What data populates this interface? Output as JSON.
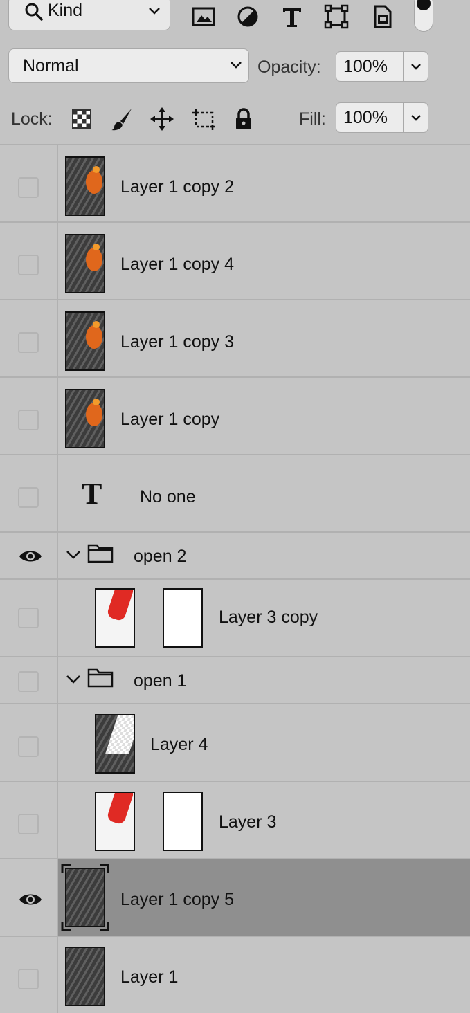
{
  "filter_bar": {
    "kind_label": "Kind",
    "filter_icons": [
      "pixel-filter-icon",
      "adjustment-filter-icon",
      "type-filter-icon",
      "shape-filter-icon",
      "smart-object-filter-icon"
    ]
  },
  "blend_row": {
    "mode": "Normal",
    "opacity_label": "Opacity:",
    "opacity_value": "100%"
  },
  "lock_row": {
    "lock_label": "Lock:",
    "lock_icons": [
      "lock-transparent-icon",
      "lock-pixels-icon",
      "lock-position-icon",
      "lock-artboard-icon",
      "lock-all-icon"
    ],
    "fill_label": "Fill:",
    "fill_value": "100%"
  },
  "layers": [
    {
      "name": "Layer 1 copy 2",
      "type": "pixel",
      "visible": false
    },
    {
      "name": "Layer 1 copy 4",
      "type": "pixel",
      "visible": false
    },
    {
      "name": "Layer 1 copy 3",
      "type": "pixel",
      "visible": false
    },
    {
      "name": "Layer 1 copy",
      "type": "pixel",
      "visible": false
    },
    {
      "name": "No one",
      "type": "text",
      "visible": false
    },
    {
      "name": "open 2",
      "type": "group",
      "visible": true,
      "expanded": true
    },
    {
      "name": "Layer 3 copy",
      "type": "masked",
      "visible": false,
      "indent": 1
    },
    {
      "name": "open 1",
      "type": "group",
      "visible": false,
      "expanded": true
    },
    {
      "name": "Layer 4",
      "type": "pixel-transparent",
      "visible": false,
      "indent": 1
    },
    {
      "name": "Layer 3",
      "type": "masked",
      "visible": false,
      "indent": 1
    },
    {
      "name": "Layer 1 copy 5",
      "type": "pixel",
      "visible": true,
      "selected": true
    },
    {
      "name": "Layer 1",
      "type": "pixel",
      "visible": false
    }
  ],
  "colors": {
    "panel_bg": "#c4c4c4",
    "selected_row": "#8f8f8f",
    "thumb_orange": "#e0671c",
    "thumb_red": "#e02a24"
  }
}
